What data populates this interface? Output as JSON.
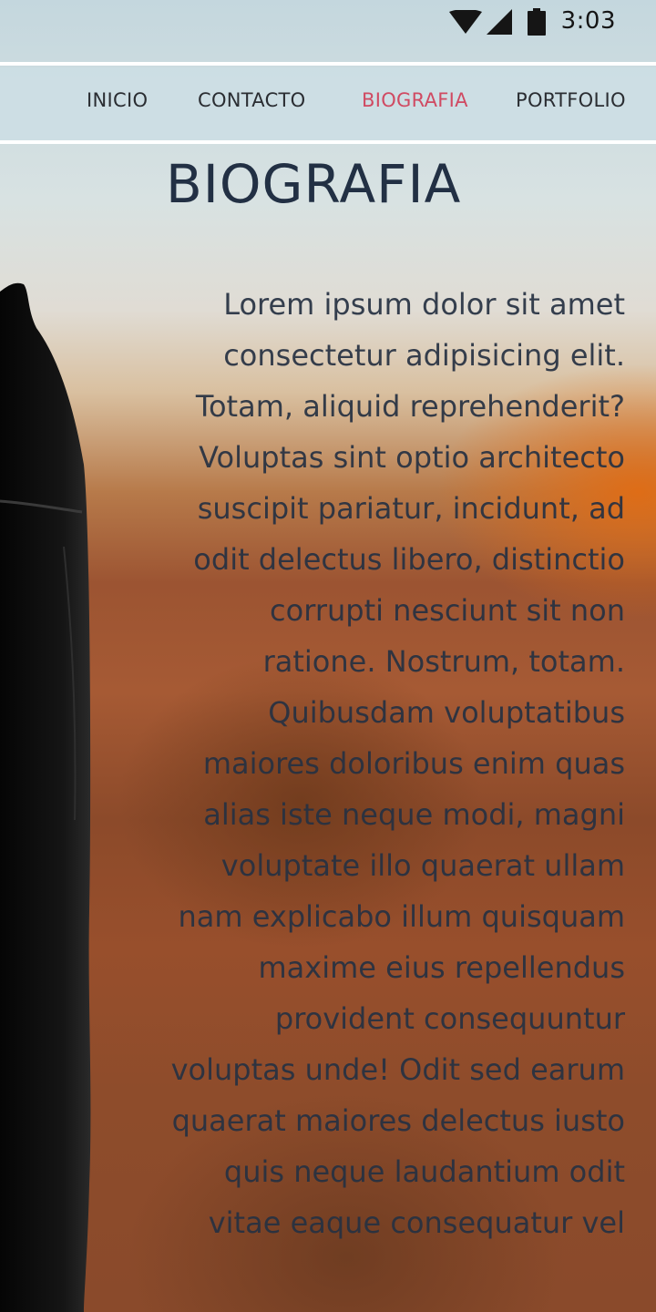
{
  "status_bar": {
    "time": "3:03",
    "icons": [
      "wifi-icon",
      "signal-icon",
      "battery-icon"
    ]
  },
  "nav": {
    "items": [
      {
        "label": "INICIO",
        "active": false
      },
      {
        "label": "CONTACTO",
        "active": false
      },
      {
        "label": "BIOGRAFIA",
        "active": true
      },
      {
        "label": "PORTFOLIO",
        "active": false
      }
    ],
    "active_color": "#d04a62",
    "text_color": "#2a2d32"
  },
  "page": {
    "title": "BIOGRAFIA",
    "title_color": "#223044",
    "bio_lines": [
      "Lorem ipsum dolor sit amet",
      "consectetur adipisicing elit.",
      "Totam, aliquid reprehenderit?",
      "Voluptas sint optio architecto",
      "suscipit pariatur, incidunt, ad",
      "odit delectus libero, distinctio",
      "corrupti nesciunt sit non",
      "ratione. Nostrum, totam.",
      "Quibusdam voluptatibus",
      "maiores doloribus enim quas",
      "alias iste neque modi, magni",
      "voluptate illo quaerat ullam",
      "nam explicabo illum quisquam",
      "maxime eius repellendus",
      "provident consequuntur",
      "voluptas unde! Odit sed earum",
      "quaerat maiores delectus iusto",
      "quis neque laudantium odit",
      "vitae eaque consequatur vel"
    ]
  },
  "background": {
    "image": "blurred-camera-photo",
    "accent_orange": "#e06c14"
  }
}
